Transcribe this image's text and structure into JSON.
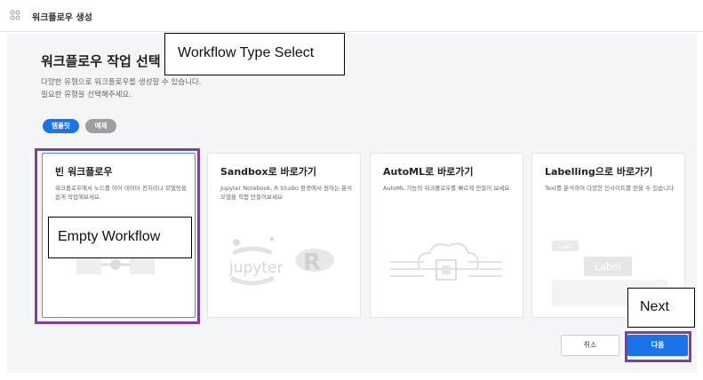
{
  "header": {
    "title": "워크플로우 생성",
    "icon": "apps-grid-icon"
  },
  "main": {
    "title": "워크플로우 작업 선택",
    "description_line1": "다양한 유형으로 워크플로우를 생성할 수 있습니다.",
    "description_line2": "필요한 유형을 선택해주세요.",
    "tabs": [
      {
        "label": "템플릿",
        "active": true
      },
      {
        "label": "예제",
        "active": false
      }
    ],
    "cards": [
      {
        "title": "빈 워크플로우",
        "description": "워크플로우에서 노드를 이어 데이터 전처리나 모델링을 쉽게 작업해보세요.",
        "selected": true
      },
      {
        "title": "Sandbox로 바로가기",
        "description": "Jupyter Notebook, R Studio 환경에서 원하는 분석 모델을 직접 만들어보세요",
        "art_text": "jupyter",
        "art_letter": "R",
        "selected": false
      },
      {
        "title": "AutoML로 바로가기",
        "description": "AutoML 기능의 워크플로우를 빠르게 만들어 보세요",
        "selected": false
      },
      {
        "title": "Labelling으로 바로가기",
        "description": "Text를 분석하여 다양한 인사이트를 얻을 수 있습니다",
        "art_small": "Label",
        "art_big": "Label",
        "selected": false
      }
    ],
    "buttons": {
      "cancel": "취소",
      "next": "다음"
    }
  },
  "annotations": {
    "workflow_type_select": "Workflow Type Select",
    "empty_workflow": "Empty Workflow",
    "next": "Next"
  },
  "colors": {
    "accent": "#1a73e8",
    "annotation": "#7b3fa6",
    "panel_bg": "#f4f5f7"
  }
}
